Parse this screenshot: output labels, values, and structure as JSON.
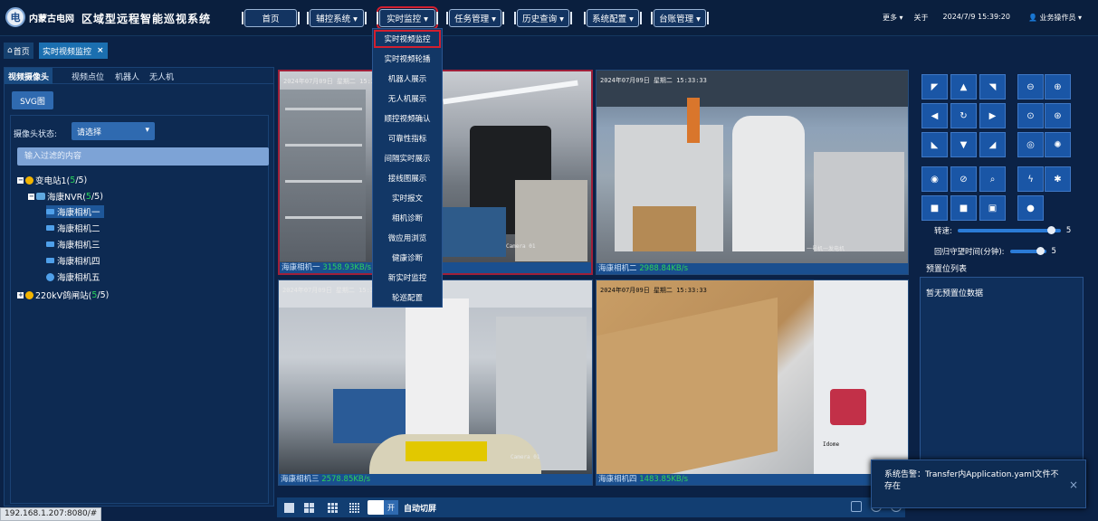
{
  "header": {
    "logo_text": "内蒙古电网",
    "title": "区域型远程智能巡视系统",
    "nav": [
      {
        "label": "首页"
      },
      {
        "label": "辅控系统 ▾"
      },
      {
        "label": "实时监控 ▾"
      },
      {
        "label": "任务管理 ▾"
      },
      {
        "label": "历史查询 ▾"
      },
      {
        "label": "系统配置 ▾"
      },
      {
        "label": "台账管理 ▾"
      }
    ],
    "more": "更多 ▾",
    "about": "关于",
    "datetime": "2024/7/9 15:39:20",
    "user": "👤 业务操作员 ▾"
  },
  "dropdown": {
    "items": [
      "实时视频监控",
      "实时视频轮播",
      "机器人展示",
      "无人机展示",
      "顺控视频确认",
      "可靠性指标",
      "间隔实时展示",
      "接线图展示",
      "实时报文",
      "相机诊断",
      "微应用浏览",
      "健康诊断",
      "新实时监控",
      "轮巡配置"
    ],
    "active_index": 0
  },
  "tabs": {
    "home": "首页",
    "home_icon": "home-icon",
    "current": "实时视频监控",
    "close": "×"
  },
  "left": {
    "subtabs": [
      "视频摄像头",
      "视频点位",
      "机器人",
      "无人机"
    ],
    "svg_button": "SVG图",
    "camera_status_label": "摄像头状态:",
    "camera_status_value": "请选择",
    "filter_placeholder": "输入过滤的内容",
    "tree": {
      "station1": {
        "name": "变电站1(",
        "count": "5",
        "total": "/5)"
      },
      "nvr": {
        "name": "海康NVR(",
        "count": "5",
        "total": "/5)"
      },
      "cameras": [
        "海康相机一",
        "海康相机二",
        "海康相机三",
        "海康相机四",
        "海康相机五"
      ],
      "station2": {
        "name": "220kV鸽闸站(",
        "count": "5",
        "total": "/5)"
      }
    }
  },
  "videos": [
    {
      "name": "海康相机一 ",
      "rate": "3158.93KB/s",
      "osd": "2024年07月09日 星期二 15:33:33",
      "osd_bottom": "Camera 01"
    },
    {
      "name": "海康相机二 ",
      "rate": "2988.84KB/s",
      "osd": "2024年07月09日 星期二 15:33:33",
      "osd_bottom": "一号机一发电机"
    },
    {
      "name": "海康相机三 ",
      "rate": "2578.85KB/s",
      "osd": "2024年07月09日 星期二 15:33:33",
      "osd_bottom": "Camera 01"
    },
    {
      "name": "海康相机四 ",
      "rate": "1483.85KB/s",
      "osd": "2024年07月09日 星期二 15:33:33",
      "osd_bottom": "Idome"
    }
  ],
  "bottom": {
    "toggle": "开",
    "auto_switch": "自动切屏"
  },
  "right": {
    "speed_label": "转速:",
    "speed_value": "5",
    "return_label": "回归守望时间(分钟):",
    "return_value": "5",
    "preset_title": "预置位列表",
    "preset_empty": "暂无预置位数据"
  },
  "toast": {
    "text": "系统告警：Transfer内Application.yaml文件不存在",
    "close": "×"
  },
  "status_url": "192.168.1.207:8080/#"
}
